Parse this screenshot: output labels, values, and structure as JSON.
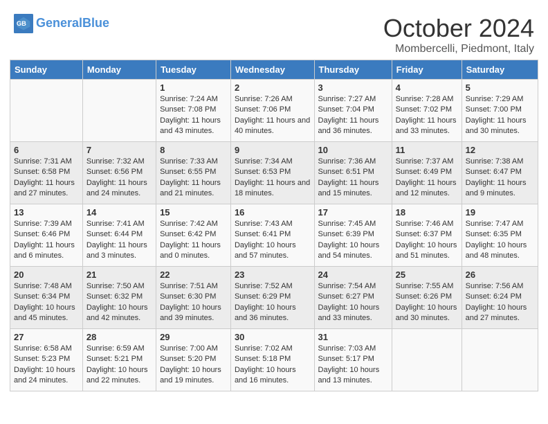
{
  "header": {
    "logo_line1": "General",
    "logo_line2": "Blue",
    "month": "October 2024",
    "location": "Mombercelli, Piedmont, Italy"
  },
  "days_of_week": [
    "Sunday",
    "Monday",
    "Tuesday",
    "Wednesday",
    "Thursday",
    "Friday",
    "Saturday"
  ],
  "weeks": [
    [
      {
        "day": "",
        "sunrise": "",
        "sunset": "",
        "daylight": ""
      },
      {
        "day": "",
        "sunrise": "",
        "sunset": "",
        "daylight": ""
      },
      {
        "day": "1",
        "sunrise": "Sunrise: 7:24 AM",
        "sunset": "Sunset: 7:08 PM",
        "daylight": "Daylight: 11 hours and 43 minutes."
      },
      {
        "day": "2",
        "sunrise": "Sunrise: 7:26 AM",
        "sunset": "Sunset: 7:06 PM",
        "daylight": "Daylight: 11 hours and 40 minutes."
      },
      {
        "day": "3",
        "sunrise": "Sunrise: 7:27 AM",
        "sunset": "Sunset: 7:04 PM",
        "daylight": "Daylight: 11 hours and 36 minutes."
      },
      {
        "day": "4",
        "sunrise": "Sunrise: 7:28 AM",
        "sunset": "Sunset: 7:02 PM",
        "daylight": "Daylight: 11 hours and 33 minutes."
      },
      {
        "day": "5",
        "sunrise": "Sunrise: 7:29 AM",
        "sunset": "Sunset: 7:00 PM",
        "daylight": "Daylight: 11 hours and 30 minutes."
      }
    ],
    [
      {
        "day": "6",
        "sunrise": "Sunrise: 7:31 AM",
        "sunset": "Sunset: 6:58 PM",
        "daylight": "Daylight: 11 hours and 27 minutes."
      },
      {
        "day": "7",
        "sunrise": "Sunrise: 7:32 AM",
        "sunset": "Sunset: 6:56 PM",
        "daylight": "Daylight: 11 hours and 24 minutes."
      },
      {
        "day": "8",
        "sunrise": "Sunrise: 7:33 AM",
        "sunset": "Sunset: 6:55 PM",
        "daylight": "Daylight: 11 hours and 21 minutes."
      },
      {
        "day": "9",
        "sunrise": "Sunrise: 7:34 AM",
        "sunset": "Sunset: 6:53 PM",
        "daylight": "Daylight: 11 hours and 18 minutes."
      },
      {
        "day": "10",
        "sunrise": "Sunrise: 7:36 AM",
        "sunset": "Sunset: 6:51 PM",
        "daylight": "Daylight: 11 hours and 15 minutes."
      },
      {
        "day": "11",
        "sunrise": "Sunrise: 7:37 AM",
        "sunset": "Sunset: 6:49 PM",
        "daylight": "Daylight: 11 hours and 12 minutes."
      },
      {
        "day": "12",
        "sunrise": "Sunrise: 7:38 AM",
        "sunset": "Sunset: 6:47 PM",
        "daylight": "Daylight: 11 hours and 9 minutes."
      }
    ],
    [
      {
        "day": "13",
        "sunrise": "Sunrise: 7:39 AM",
        "sunset": "Sunset: 6:46 PM",
        "daylight": "Daylight: 11 hours and 6 minutes."
      },
      {
        "day": "14",
        "sunrise": "Sunrise: 7:41 AM",
        "sunset": "Sunset: 6:44 PM",
        "daylight": "Daylight: 11 hours and 3 minutes."
      },
      {
        "day": "15",
        "sunrise": "Sunrise: 7:42 AM",
        "sunset": "Sunset: 6:42 PM",
        "daylight": "Daylight: 11 hours and 0 minutes."
      },
      {
        "day": "16",
        "sunrise": "Sunrise: 7:43 AM",
        "sunset": "Sunset: 6:41 PM",
        "daylight": "Daylight: 10 hours and 57 minutes."
      },
      {
        "day": "17",
        "sunrise": "Sunrise: 7:45 AM",
        "sunset": "Sunset: 6:39 PM",
        "daylight": "Daylight: 10 hours and 54 minutes."
      },
      {
        "day": "18",
        "sunrise": "Sunrise: 7:46 AM",
        "sunset": "Sunset: 6:37 PM",
        "daylight": "Daylight: 10 hours and 51 minutes."
      },
      {
        "day": "19",
        "sunrise": "Sunrise: 7:47 AM",
        "sunset": "Sunset: 6:35 PM",
        "daylight": "Daylight: 10 hours and 48 minutes."
      }
    ],
    [
      {
        "day": "20",
        "sunrise": "Sunrise: 7:48 AM",
        "sunset": "Sunset: 6:34 PM",
        "daylight": "Daylight: 10 hours and 45 minutes."
      },
      {
        "day": "21",
        "sunrise": "Sunrise: 7:50 AM",
        "sunset": "Sunset: 6:32 PM",
        "daylight": "Daylight: 10 hours and 42 minutes."
      },
      {
        "day": "22",
        "sunrise": "Sunrise: 7:51 AM",
        "sunset": "Sunset: 6:30 PM",
        "daylight": "Daylight: 10 hours and 39 minutes."
      },
      {
        "day": "23",
        "sunrise": "Sunrise: 7:52 AM",
        "sunset": "Sunset: 6:29 PM",
        "daylight": "Daylight: 10 hours and 36 minutes."
      },
      {
        "day": "24",
        "sunrise": "Sunrise: 7:54 AM",
        "sunset": "Sunset: 6:27 PM",
        "daylight": "Daylight: 10 hours and 33 minutes."
      },
      {
        "day": "25",
        "sunrise": "Sunrise: 7:55 AM",
        "sunset": "Sunset: 6:26 PM",
        "daylight": "Daylight: 10 hours and 30 minutes."
      },
      {
        "day": "26",
        "sunrise": "Sunrise: 7:56 AM",
        "sunset": "Sunset: 6:24 PM",
        "daylight": "Daylight: 10 hours and 27 minutes."
      }
    ],
    [
      {
        "day": "27",
        "sunrise": "Sunrise: 6:58 AM",
        "sunset": "Sunset: 5:23 PM",
        "daylight": "Daylight: 10 hours and 24 minutes."
      },
      {
        "day": "28",
        "sunrise": "Sunrise: 6:59 AM",
        "sunset": "Sunset: 5:21 PM",
        "daylight": "Daylight: 10 hours and 22 minutes."
      },
      {
        "day": "29",
        "sunrise": "Sunrise: 7:00 AM",
        "sunset": "Sunset: 5:20 PM",
        "daylight": "Daylight: 10 hours and 19 minutes."
      },
      {
        "day": "30",
        "sunrise": "Sunrise: 7:02 AM",
        "sunset": "Sunset: 5:18 PM",
        "daylight": "Daylight: 10 hours and 16 minutes."
      },
      {
        "day": "31",
        "sunrise": "Sunrise: 7:03 AM",
        "sunset": "Sunset: 5:17 PM",
        "daylight": "Daylight: 10 hours and 13 minutes."
      },
      {
        "day": "",
        "sunrise": "",
        "sunset": "",
        "daylight": ""
      },
      {
        "day": "",
        "sunrise": "",
        "sunset": "",
        "daylight": ""
      }
    ]
  ]
}
